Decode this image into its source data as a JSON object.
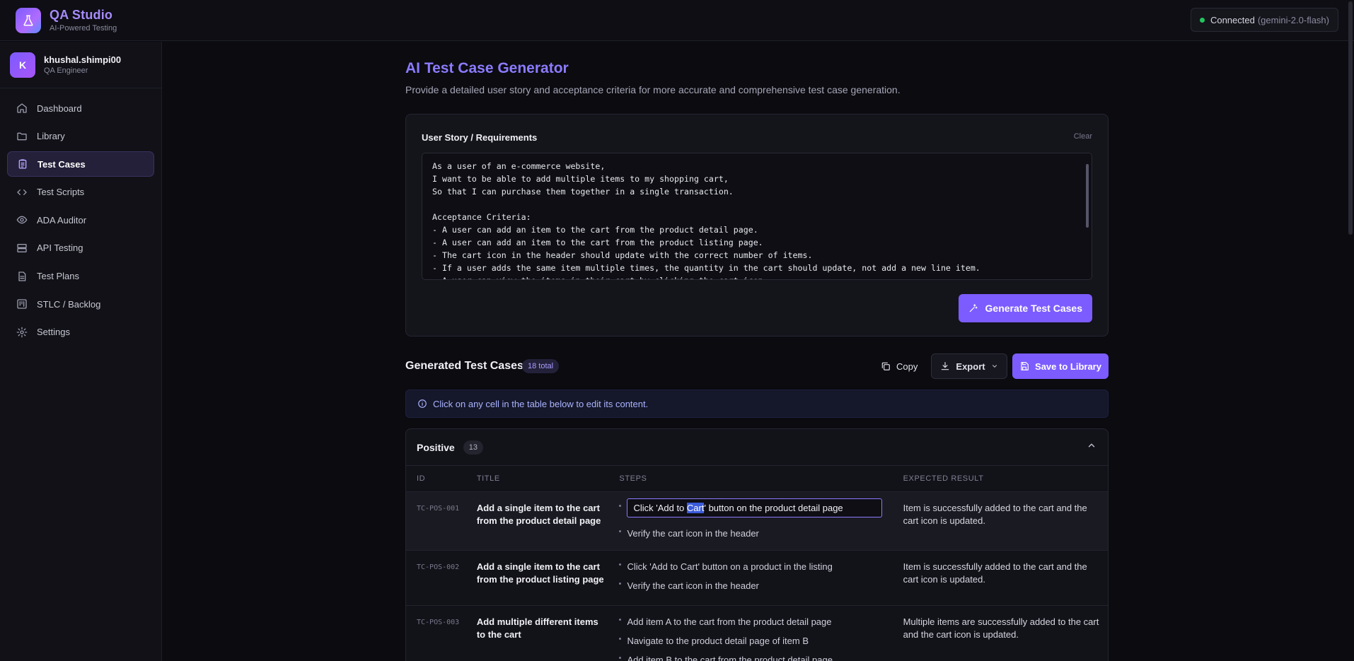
{
  "app": {
    "title": "QA Studio",
    "subtitle": "AI-Powered Testing"
  },
  "connection": {
    "status": "Connected",
    "model": "(gemini-2.0-flash)",
    "status_color": "#22c55e"
  },
  "user": {
    "initial": "K",
    "name": "khushal.shimpi00",
    "role": "QA Engineer"
  },
  "sidebar": {
    "items": [
      {
        "label": "Dashboard",
        "icon": "home-icon"
      },
      {
        "label": "Library",
        "icon": "folder-icon"
      },
      {
        "label": "Test Cases",
        "icon": "clipboard-icon",
        "active": true
      },
      {
        "label": "Test Scripts",
        "icon": "code-icon"
      },
      {
        "label": "ADA Auditor",
        "icon": "eye-icon"
      },
      {
        "label": "API Testing",
        "icon": "server-icon"
      },
      {
        "label": "Test Plans",
        "icon": "document-icon"
      },
      {
        "label": "STLC / Backlog",
        "icon": "kanban-icon"
      },
      {
        "label": "Settings",
        "icon": "gear-icon"
      }
    ]
  },
  "page": {
    "title": "AI Test Case Generator",
    "description": "Provide a detailed user story and acceptance criteria for more accurate and comprehensive test case generation."
  },
  "input": {
    "label": "User Story / Requirements",
    "clear_label": "Clear",
    "value": "As a user of an e-commerce website,\nI want to be able to add multiple items to my shopping cart,\nSo that I can purchase them together in a single transaction.\n\nAcceptance Criteria:\n- A user can add an item to the cart from the product detail page.\n- A user can add an item to the cart from the product listing page.\n- The cart icon in the header should update with the correct number of items.\n- If a user adds the same item multiple times, the quantity in the cart should update, not add a new line item.\n- A user can view the items in their cart by clicking the cart icon.",
    "generate_label": "Generate Test Cases"
  },
  "results": {
    "title": "Generated Test Cases",
    "total_badge": "18 total",
    "copy_label": "Copy",
    "export_label": "Export",
    "save_label": "Save to Library",
    "info": "Click on any cell in the table below to edit its content."
  },
  "section": {
    "title": "Positive",
    "count": "13",
    "columns": [
      "ID",
      "TITLE",
      "STEPS",
      "EXPECTED RESULT"
    ],
    "rows": [
      {
        "id": "TC-POS-001",
        "title": "Add a single item to the cart from the product detail page",
        "edit_step_before": "Click 'Add to ",
        "edit_step_selected": "Cart",
        "edit_step_after": "' button on the product detail page",
        "steps": [
          "Verify the cart icon in the header"
        ],
        "expected": "Item is successfully added to the cart and the cart icon is updated."
      },
      {
        "id": "TC-POS-002",
        "title": "Add a single item to the cart from the product listing page",
        "steps": [
          "Click 'Add to Cart' button on a product in the listing",
          "Verify the cart icon in the header"
        ],
        "expected": "Item is successfully added to the cart and the cart icon is updated."
      },
      {
        "id": "TC-POS-003",
        "title": "Add multiple different items to the cart",
        "steps": [
          "Add item A to the cart from the product detail page",
          "Navigate to the product detail page of item B",
          "Add item B to the cart from the product detail page"
        ],
        "expected": "Multiple items are successfully added to the cart and the cart icon is updated."
      }
    ]
  }
}
